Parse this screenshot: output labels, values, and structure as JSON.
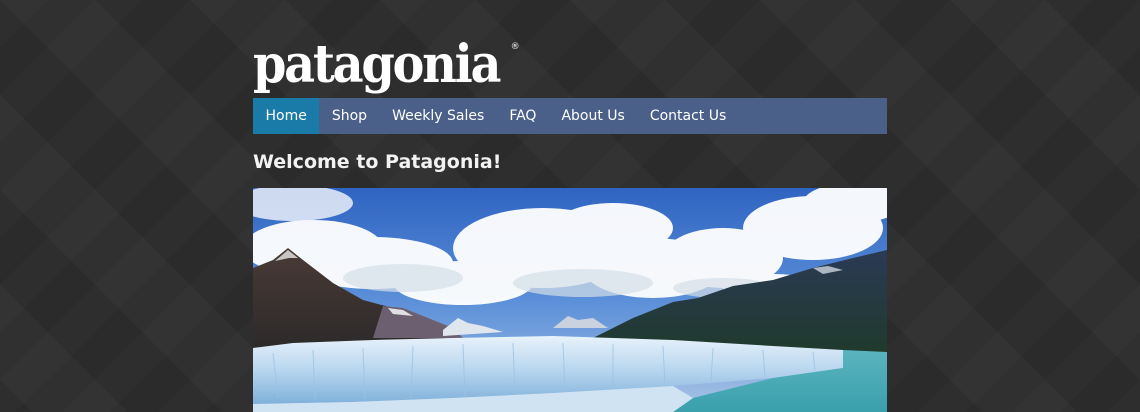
{
  "brand": {
    "logo_text": "patagonia",
    "registered_mark": "®"
  },
  "nav": {
    "items": [
      {
        "label": "Home",
        "active": true
      },
      {
        "label": "Shop",
        "active": false
      },
      {
        "label": "Weekly Sales",
        "active": false
      },
      {
        "label": "FAQ",
        "active": false
      },
      {
        "label": "About Us",
        "active": false
      },
      {
        "label": "Contact Us",
        "active": false
      }
    ]
  },
  "main": {
    "heading": "Welcome to Patagonia!"
  },
  "colors": {
    "background": "#2e2e2e",
    "nav_bar": "#4a6088",
    "nav_active": "#1a7aa8",
    "text": "#ffffff"
  }
}
